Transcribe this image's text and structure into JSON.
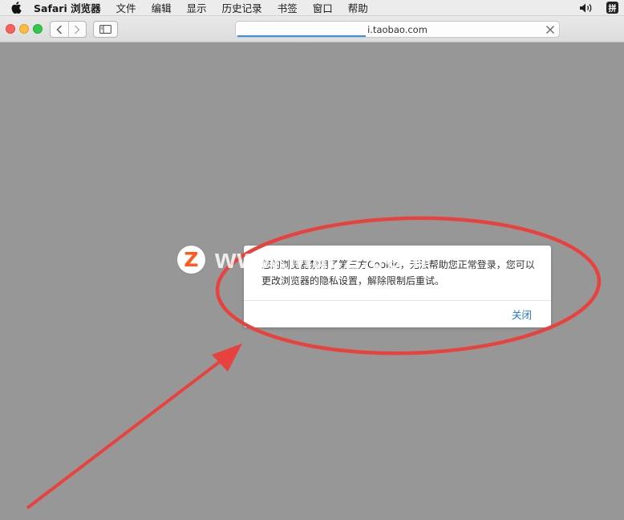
{
  "menubar": {
    "app_name": "Safari 浏览器",
    "items": [
      "文件",
      "编辑",
      "显示",
      "历史记录",
      "书签",
      "窗口",
      "帮助"
    ],
    "input_method": "拼"
  },
  "browser": {
    "url": "i.taobao.com",
    "load_progress": 0.4
  },
  "dialog": {
    "message": "您的浏览器禁用了第三方Cookie，无法帮助您正常登录，您可以更改浏览器的隐私设置，解除限制后重试。",
    "close_label": "关闭"
  },
  "watermark": {
    "logo_letter": "Z",
    "text": "www.MacZ.com"
  },
  "colors": {
    "page_background": "#979797",
    "annotation_red": "#e8423f",
    "link_blue": "#2276d2"
  }
}
